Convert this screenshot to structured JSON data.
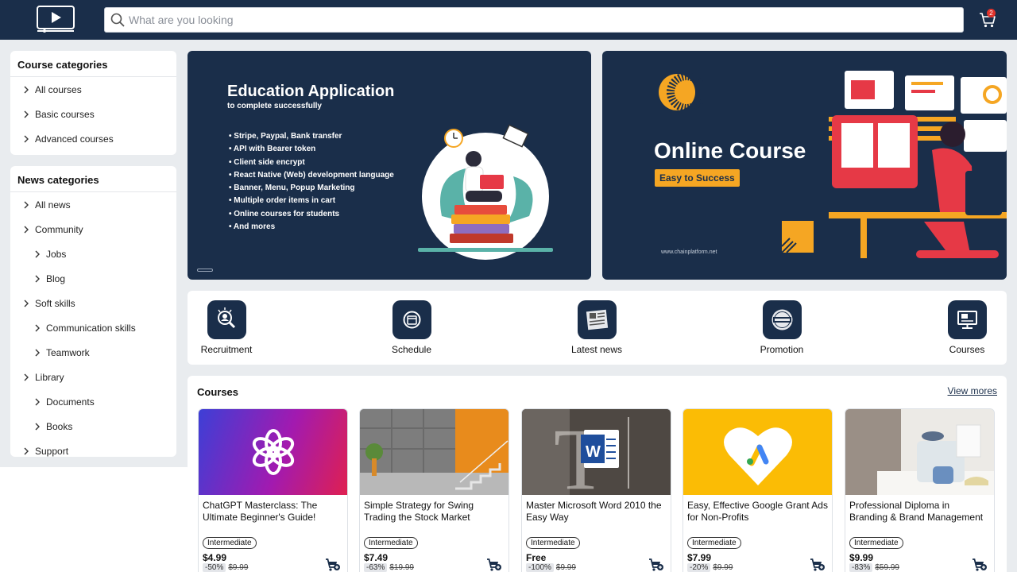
{
  "header": {
    "search_placeholder": "What are you looking",
    "cart_count": "2"
  },
  "sidebar": {
    "course_categories": {
      "title": "Course categories",
      "items": [
        "All courses",
        "Basic courses",
        "Advanced courses"
      ]
    },
    "news_categories": {
      "title": "News categories",
      "items": [
        {
          "label": "All news",
          "level": 1
        },
        {
          "label": "Community",
          "level": 1
        },
        {
          "label": "Jobs",
          "level": 2
        },
        {
          "label": "Blog",
          "level": 2
        },
        {
          "label": "Soft skills",
          "level": 1
        },
        {
          "label": "Communication skills",
          "level": 2
        },
        {
          "label": "Teamwork",
          "level": 2
        },
        {
          "label": "Library",
          "level": 1
        },
        {
          "label": "Documents",
          "level": 2
        },
        {
          "label": "Books",
          "level": 2
        },
        {
          "label": "Support",
          "level": 1
        }
      ]
    }
  },
  "banners": {
    "left": {
      "title": "Education Application",
      "subtitle": "to complete successfully",
      "features": [
        "Stripe, Paypal, Bank transfer",
        "API with Bearer token",
        "Client side encrypt",
        "React Native (Web) development language",
        "Banner, Menu, Popup Marketing",
        "Multiple order items in cart",
        "Online courses for students",
        "And mores"
      ]
    },
    "right": {
      "title": "Online Course",
      "badge": "Easy to Success",
      "url": "www.chainplatform.net"
    }
  },
  "quick_links": [
    {
      "label": "Recruitment",
      "icon": "recruitment-icon"
    },
    {
      "label": "Schedule",
      "icon": "schedule-icon"
    },
    {
      "label": "Latest news",
      "icon": "newspaper-icon"
    },
    {
      "label": "Promotion",
      "icon": "best-seller-icon"
    },
    {
      "label": "Courses",
      "icon": "courses-icon"
    }
  ],
  "courses": {
    "title": "Courses",
    "view_more": "View mores",
    "items": [
      {
        "title": "ChatGPT Masterclass: The Ultimate Beginner's Guide!",
        "level": "Intermediate",
        "price": "$4.99",
        "discount": "-50%",
        "old_price": "$9.99"
      },
      {
        "title": "Simple Strategy for Swing Trading the Stock Market",
        "level": "Intermediate",
        "price": "$7.49",
        "discount": "-63%",
        "old_price": "$19.99"
      },
      {
        "title": "Master Microsoft Word 2010 the Easy Way",
        "level": "Intermediate",
        "price": "Free",
        "discount": "-100%",
        "old_price": "$9.99"
      },
      {
        "title": "Easy, Effective Google Grant Ads for Non-Profits",
        "level": "Intermediate",
        "price": "$7.99",
        "discount": "-20%",
        "old_price": "$9.99"
      },
      {
        "title": "Professional Diploma in Branding & Brand Management",
        "level": "Intermediate",
        "price": "$9.99",
        "discount": "-83%",
        "old_price": "$59.99"
      }
    ]
  },
  "colors": {
    "navy": "#1a2e4a",
    "accent": "#f5a623",
    "badge_red": "#e0322b"
  }
}
